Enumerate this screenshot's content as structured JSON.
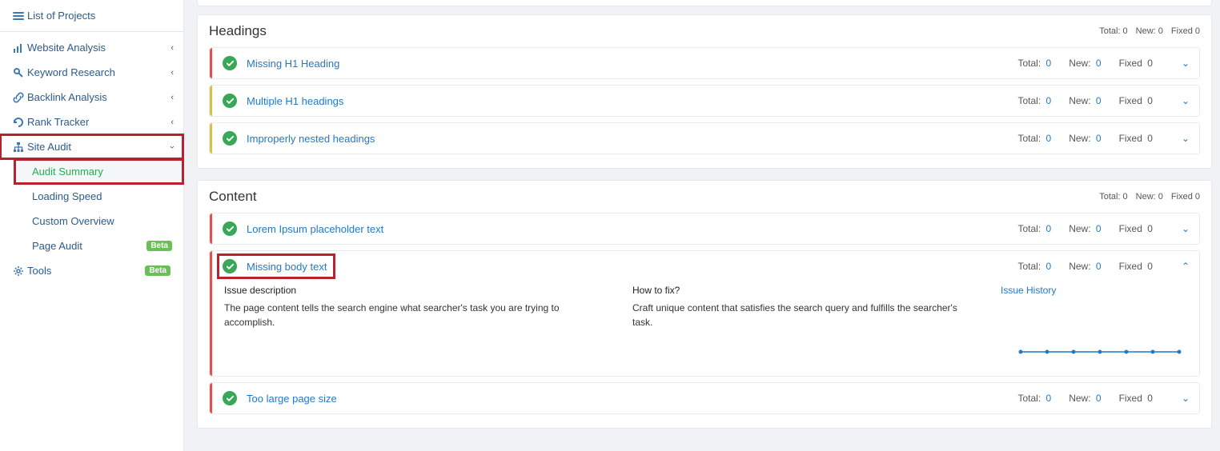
{
  "sidebar": {
    "projects": "List of Projects",
    "website_analysis": "Website Analysis",
    "keyword_research": "Keyword Research",
    "backlink_analysis": "Backlink Analysis",
    "rank_tracker": "Rank Tracker",
    "site_audit": "Site Audit",
    "audit_summary": "Audit Summary",
    "loading_speed": "Loading Speed",
    "custom_overview": "Custom Overview",
    "page_audit": "Page Audit",
    "tools": "Tools",
    "beta": "Beta"
  },
  "labels": {
    "total": "Total:",
    "new": "New:",
    "fixed": "Fixed",
    "issue_desc": "Issue description",
    "how_fix": "How to fix?",
    "issue_history": "Issue History"
  },
  "sections": [
    {
      "title": "Headings",
      "total": 0,
      "new": 0,
      "fixed": 0,
      "issues": [
        {
          "title": "Missing H1 Heading",
          "sev": "red",
          "total": 0,
          "new": 0,
          "fixed": 0
        },
        {
          "title": "Multiple H1 headings",
          "sev": "yellow",
          "total": 0,
          "new": 0,
          "fixed": 0
        },
        {
          "title": "Improperly nested headings",
          "sev": "yellow",
          "total": 0,
          "new": 0,
          "fixed": 0
        }
      ]
    },
    {
      "title": "Content",
      "total": 0,
      "new": 0,
      "fixed": 0,
      "issues": [
        {
          "title": "Lorem Ipsum placeholder text",
          "sev": "red",
          "total": 0,
          "new": 0,
          "fixed": 0
        },
        {
          "title": "Missing body text",
          "sev": "red",
          "total": 0,
          "new": 0,
          "fixed": 0,
          "expanded": true,
          "desc": "The page content tells the search engine what searcher's task you are trying to accomplish.",
          "fix": "Craft unique content that satisfies the search query and fulfills the searcher's task."
        },
        {
          "title": "Too large page size",
          "sev": "red",
          "total": 0,
          "new": 0,
          "fixed": 0
        }
      ]
    }
  ]
}
